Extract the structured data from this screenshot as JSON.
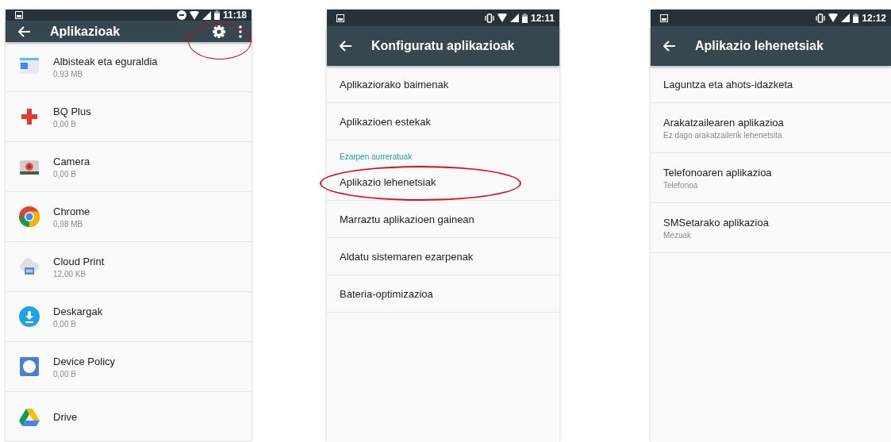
{
  "screens": [
    {
      "status_bar": {
        "time": "11:18"
      },
      "app_bar": {
        "title": "Aplikazioak",
        "actions": [
          {
            "kind": "settings",
            "circled": true
          },
          {
            "kind": "overflow",
            "circled": false
          }
        ]
      },
      "list": [
        {
          "kind": "app",
          "title": "Albisteak eta eguraldia",
          "subtitle": "0,93 MB",
          "circled": false
        },
        {
          "kind": "app",
          "title": "BQ Plus",
          "subtitle": "0,00 B",
          "circled": false
        },
        {
          "kind": "app",
          "title": "Camera",
          "subtitle": "0,00 B",
          "circled": false
        },
        {
          "kind": "app",
          "title": "Chrome",
          "subtitle": "0,98 MB",
          "circled": false
        },
        {
          "kind": "app",
          "title": "Cloud Print",
          "subtitle": "12,00 KB",
          "circled": false
        },
        {
          "kind": "app",
          "title": "Deskargak",
          "subtitle": "0,00 B",
          "circled": false
        },
        {
          "kind": "app",
          "title": "Device Policy",
          "subtitle": "0,00 B",
          "circled": false
        },
        {
          "kind": "app",
          "title": "Drive",
          "circled": false
        }
      ]
    },
    {
      "status_bar": {
        "time": "12:11"
      },
      "app_bar": {
        "title": "Konfiguratu aplikazioak"
      },
      "list": [
        {
          "kind": "item",
          "title": "Aplikaziorako baimenak",
          "circled": false
        },
        {
          "kind": "item",
          "title": "Aplikazioen estekak",
          "circled": false
        },
        {
          "kind": "header",
          "title": "Ezarpen aurreratuak",
          "circled": false
        },
        {
          "kind": "item",
          "title": "Aplikazio lehenetsiak",
          "circled": true
        },
        {
          "kind": "item",
          "title": "Marraztu aplikazioen gainean",
          "circled": false
        },
        {
          "kind": "item",
          "title": "Aldatu sistemaren ezarpenak",
          "circled": false
        },
        {
          "kind": "item",
          "title": "Bateria-optimizazioa",
          "circled": false
        }
      ]
    },
    {
      "status_bar": {
        "time": "12:12"
      },
      "app_bar": {
        "title": "Aplikazio lehenetsiak"
      },
      "list": [
        {
          "kind": "item",
          "title": "Laguntza eta ahots-idazketa",
          "circled": false
        },
        {
          "kind": "item",
          "title": "Arakatzailearen aplikazioa",
          "subtitle": "Ez dago arakatzailerik lehenetsita",
          "circled": false
        },
        {
          "kind": "item",
          "title": "Telefonoaren aplikazioa",
          "subtitle": "Telefonoa",
          "circled": false
        },
        {
          "kind": "item",
          "title": "SMSetarako aplikazioa",
          "subtitle": "Mezuak",
          "circled": false
        }
      ]
    }
  ]
}
